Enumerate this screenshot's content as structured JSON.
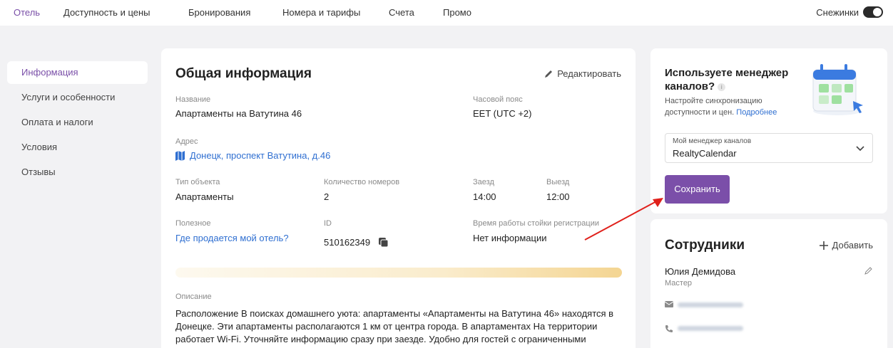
{
  "nav": {
    "tabs": [
      "Отель",
      "Доступность и цены",
      "Бронирования",
      "Номера и тарифы",
      "Счета",
      "Промо"
    ],
    "active_tab": "Отель",
    "snow_label": "Снежинки",
    "snow_toggle": "on"
  },
  "sidebar": {
    "items": [
      {
        "label": "Информация",
        "active": true
      },
      {
        "label": "Услуги и особенности"
      },
      {
        "label": "Оплата и налоги"
      },
      {
        "label": "Условия"
      },
      {
        "label": "Отзывы"
      }
    ]
  },
  "main": {
    "title": "Общая информация",
    "edit_label": "Редактировать",
    "name_label": "Название",
    "name_value": "Апартаменты на Ватутина 46",
    "timezone_label": "Часовой пояс",
    "timezone_value": "EET (UTC +2)",
    "address_label": "Адрес",
    "address_value": "Донецк, проспект Ватутина, д.46",
    "type_label": "Тип объекта",
    "type_value": "Апартаменты",
    "rooms_label": "Количество номеров",
    "rooms_value": "2",
    "checkin_label": "Заезд",
    "checkin_value": "14:00",
    "checkout_label": "Выезд",
    "checkout_value": "12:00",
    "useful_label": "Полезное",
    "useful_link": "Где продается мой отель?",
    "id_label": "ID",
    "id_value": "510162349",
    "desk_label": "Время работы стойки регистрации",
    "desk_value": "Нет информации",
    "desc_label": "Описание",
    "desc_text": "Расположение В поисках домашнего уюта: апартаменты «Апартаменты на Ватутина 46» находятся в Донецке. Эти апартаменты располагаются 1 км от центра города. В апартаментах На территории работает Wi-Fi. Уточняйте информацию сразу при заезде. Удобно для гостей с ограниченными"
  },
  "channel": {
    "title": "Используете менеджер каналов?",
    "info_mark": "i",
    "text": "Настройте синхронизацию доступности и цен.",
    "more_link": "Подробнее",
    "select_label": "Мой менеджер каналов",
    "select_value": "RealtyCalendar",
    "save_label": "Сохранить"
  },
  "staff": {
    "title": "Сотрудники",
    "add_label": "Добавить",
    "name": "Юлия Демидова",
    "role": "Мастер"
  },
  "colors": {
    "accent": "#7b4fa9",
    "link": "#2f6fd1",
    "annotation_arrow": "#e0201b"
  }
}
